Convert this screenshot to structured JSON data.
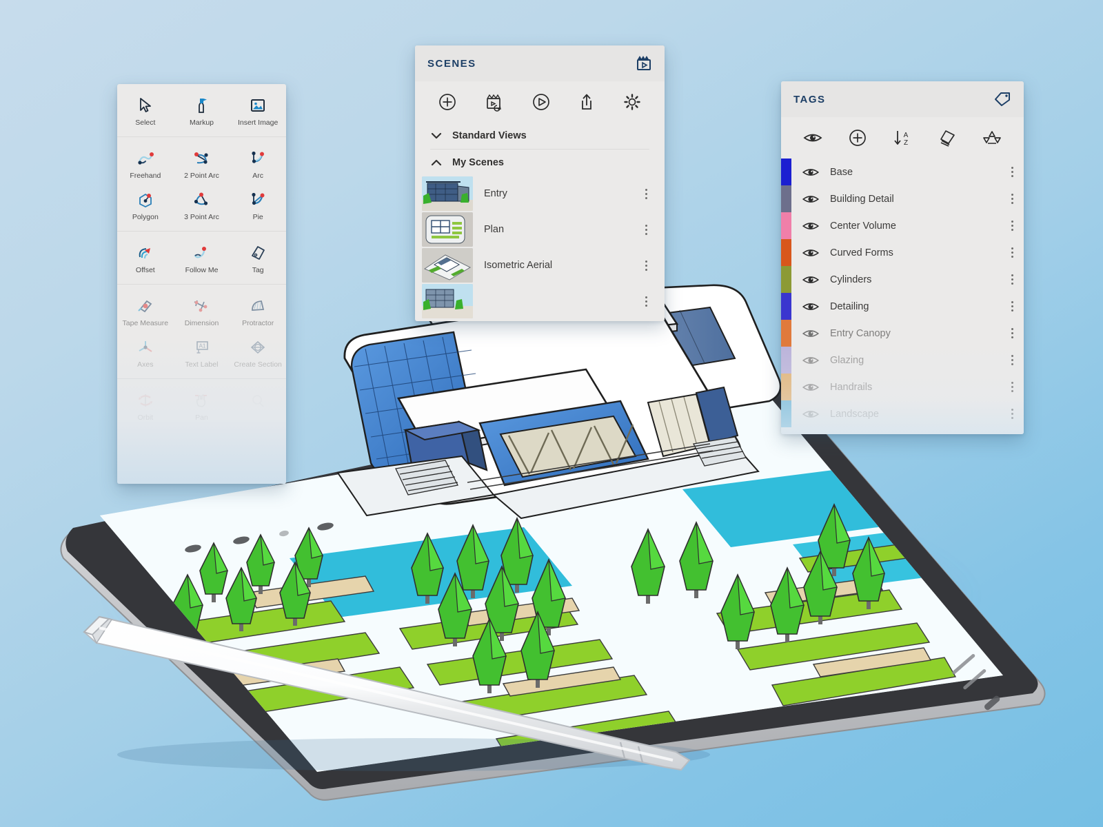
{
  "background": {
    "top_color": "#c7dcec",
    "bottom_color": "#76bfe4"
  },
  "tools_panel": {
    "name": "Tools",
    "sections": [
      {
        "items": [
          {
            "label": "Select",
            "icon": "cursor-arrow-icon",
            "state": "active"
          },
          {
            "label": "Markup",
            "icon": "marker-pen-icon",
            "state": "active"
          },
          {
            "label": "Insert Image",
            "icon": "insert-image-icon",
            "state": "active"
          }
        ]
      },
      {
        "items": [
          {
            "label": "Freehand",
            "icon": "freehand-squiggle-icon",
            "state": "active"
          },
          {
            "label": "2 Point Arc",
            "icon": "two-point-arc-icon",
            "state": "active"
          },
          {
            "label": "Arc",
            "icon": "arc-icon",
            "state": "active"
          },
          {
            "label": "Polygon",
            "icon": "polygon-icon",
            "state": "active"
          },
          {
            "label": "3 Point Arc",
            "icon": "three-point-arc-icon",
            "state": "active"
          },
          {
            "label": "Pie",
            "icon": "pie-icon",
            "state": "active"
          }
        ]
      },
      {
        "items": [
          {
            "label": "Offset",
            "icon": "offset-icon",
            "state": "active"
          },
          {
            "label": "Follow Me",
            "icon": "follow-me-icon",
            "state": "active"
          },
          {
            "label": "Tag",
            "icon": "tag-icon",
            "state": "active"
          }
        ]
      },
      {
        "items": [
          {
            "label": "Tape Measure",
            "icon": "tape-measure-icon",
            "state": "faded"
          },
          {
            "label": "Dimension",
            "icon": "dimension-icon",
            "state": "faded"
          },
          {
            "label": "Protractor",
            "icon": "protractor-icon",
            "state": "faded"
          },
          {
            "label": "Axes",
            "icon": "axes-icon",
            "state": "faded"
          },
          {
            "label": "Text Label",
            "icon": "text-label-icon",
            "state": "faded"
          },
          {
            "label": "Create Section",
            "icon": "create-section-icon",
            "state": "faded"
          }
        ]
      },
      {
        "items": [
          {
            "label": "Orbit",
            "icon": "orbit-icon",
            "state": "occluded"
          },
          {
            "label": "Pan",
            "icon": "pan-hand-icon",
            "state": "occluded"
          },
          {
            "label": "",
            "icon": "zoom-icon",
            "state": "occluded"
          }
        ]
      }
    ]
  },
  "scenes_panel": {
    "title": "SCENES",
    "header_icon": "scene-video-icon",
    "toolbar": [
      {
        "icon": "add-scene-icon",
        "label": "Add Scene"
      },
      {
        "icon": "update-scene-icon",
        "label": "Update Scene"
      },
      {
        "icon": "play-animation-icon",
        "label": "Play Animation"
      },
      {
        "icon": "share-icon",
        "label": "Share"
      },
      {
        "icon": "gear-icon",
        "label": "Settings"
      }
    ],
    "groups": [
      {
        "label": "Standard Views",
        "expanded": false,
        "chevron": "chevron-down-icon"
      },
      {
        "label": "My Scenes",
        "expanded": true,
        "chevron": "chevron-up-icon"
      }
    ],
    "scenes": [
      {
        "name": "Entry",
        "thumb": "entry-thumb",
        "selected": true
      },
      {
        "name": "Plan",
        "thumb": "plan-thumb",
        "selected": false
      },
      {
        "name": "Isometric Aerial",
        "thumb": "isometric-aerial-thumb",
        "selected": false
      },
      {
        "name": "",
        "thumb": "fourth-scene-thumb",
        "selected": false
      }
    ]
  },
  "tags_panel": {
    "title": "TAGS",
    "header_icon": "tag-outline-icon",
    "toolbar": [
      {
        "icon": "eye-icon",
        "label": "Visibility"
      },
      {
        "icon": "add-tag-icon",
        "label": "Add Tag"
      },
      {
        "icon": "sort-az-icon",
        "label": "Sort A-Z"
      },
      {
        "icon": "tag-stack-icon",
        "label": "Tag Folder"
      },
      {
        "icon": "recycle-icon",
        "label": "Purge"
      }
    ],
    "tags": [
      {
        "name": "Base",
        "color": "#1b1fd1",
        "visible": true,
        "fade": 0
      },
      {
        "name": "Building Detail",
        "color": "#6d6f8c",
        "visible": true,
        "fade": 0
      },
      {
        "name": "Center Volume",
        "color": "#f07fa9",
        "visible": true,
        "fade": 0
      },
      {
        "name": "Curved Forms",
        "color": "#d8571c",
        "visible": true,
        "fade": 0
      },
      {
        "name": "Cylinders",
        "color": "#8c9a35",
        "visible": true,
        "fade": 0
      },
      {
        "name": "Detailing",
        "color": "#3a36cf",
        "visible": true,
        "fade": 0
      },
      {
        "name": "Entry Canopy",
        "color": "#e07a3c",
        "visible": true,
        "fade": 1
      },
      {
        "name": "Glazing",
        "color": "#bbb3da",
        "visible": true,
        "fade": 2
      },
      {
        "name": "Handrails",
        "color": "#e2b273",
        "visible": true,
        "fade": 2
      },
      {
        "name": "Landscape",
        "color": "#6bb6d8",
        "visible": true,
        "fade": 3
      }
    ]
  },
  "tablet": {
    "name": "Tablet device",
    "bezel_color": "#35363a",
    "edge_color": "#d6d7d9",
    "screen_color": "#f4fbfd"
  },
  "stylus": {
    "name": "Stylus pen",
    "body_color": "#ffffff"
  },
  "model": {
    "name": "Architectural building model",
    "building_color": "#ffffff",
    "glass_color": "#3f7fd0",
    "water_color": "#1fb7d8",
    "tree_color": "#43c030",
    "lawn_color": "#8dd02a",
    "path_color": "#e6d4ac"
  }
}
